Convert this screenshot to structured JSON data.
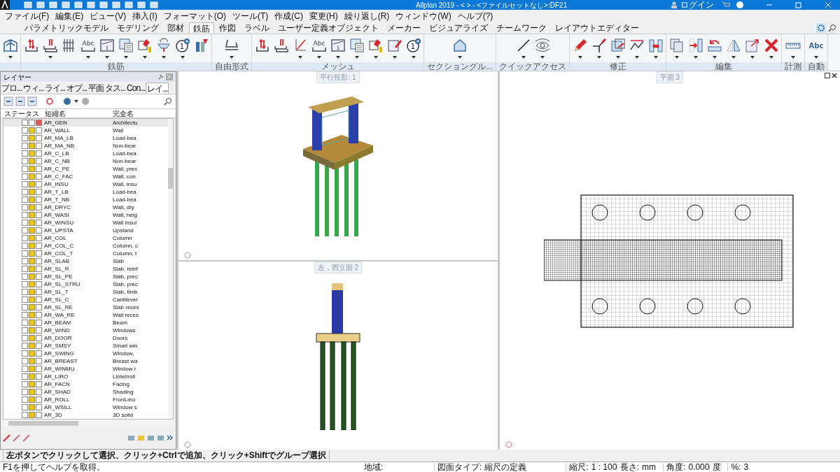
{
  "window": {
    "title": "Allplan 2019 - <        > - <ファイルセットなし>:DF21",
    "login": "ログイン"
  },
  "menu": [
    "ファイル(F)",
    "編集(E)",
    "ビュー(V)",
    "挿入(I)",
    "フォーマット(O)",
    "ツール(T)",
    "作成(C)",
    "変更(H)",
    "繰り返し(R)",
    "ウィンドウ(W)",
    "ヘルプ(?)"
  ],
  "ribbon_tabs": [
    {
      "label": "パラメトリックモデル",
      "selected": false
    },
    {
      "label": "モデリング",
      "selected": false
    },
    {
      "label": "部材",
      "selected": false
    },
    {
      "label": "鉄筋",
      "selected": true
    },
    {
      "label": "作図",
      "selected": false
    },
    {
      "label": "ラベル",
      "selected": false
    },
    {
      "label": "ユーザー定義オブジェクト",
      "selected": false
    },
    {
      "label": "メーカー",
      "selected": false
    },
    {
      "label": "ビジュアライズ",
      "selected": false
    },
    {
      "label": "チームワーク",
      "selected": false
    },
    {
      "label": "レイアウトエディター",
      "selected": false
    }
  ],
  "ribbon_groups": [
    {
      "buttons": [
        {
          "kind": "bridge",
          "dropdown": true
        }
      ]
    },
    {
      "label": "鉄筋",
      "buttons": [
        {
          "kind": "rebar",
          "dropdown": false
        },
        {
          "kind": "rebar-stack",
          "dropdown": true
        },
        {
          "kind": "bars",
          "dropdown": false
        },
        {
          "kind": "text",
          "text": "Abc",
          "dropdown": true
        },
        {
          "kind": "number-frame",
          "text": "1",
          "dropdown": true
        },
        {
          "kind": "sheet",
          "dropdown": true
        },
        {
          "kind": "paint",
          "dropdown": true
        },
        {
          "kind": "rotate-shape",
          "dropdown": true
        },
        {
          "kind": "number-circle",
          "text": "1",
          "dropdown": true
        },
        {
          "kind": "column-paint",
          "dropdown": false
        }
      ]
    },
    {
      "label": "自由形式",
      "buttons": [
        {
          "kind": "free-shape",
          "dropdown": true
        }
      ]
    },
    {
      "label": "メッシュ",
      "buttons": [
        {
          "kind": "rebar",
          "dropdown": false
        },
        {
          "kind": "rebar-stack",
          "dropdown": false
        },
        {
          "kind": "diagonal",
          "dropdown": true
        },
        {
          "kind": "text",
          "text": "Abc",
          "dropdown": true
        },
        {
          "kind": "number-frame",
          "text": "1",
          "dropdown": true
        },
        {
          "kind": "sheet",
          "dropdown": true
        },
        {
          "kind": "paint",
          "dropdown": true
        },
        {
          "kind": "pencil-frame",
          "dropdown": true
        },
        {
          "kind": "number-circle",
          "text": "1",
          "dropdown": true
        }
      ]
    },
    {
      "label": "セクショングル...",
      "buttons": [
        {
          "kind": "house",
          "dropdown": true
        }
      ]
    },
    {
      "label": "クイックアクセス",
      "buttons": [
        {
          "kind": "line",
          "dropdown": true
        },
        {
          "kind": "eye",
          "dropdown": true
        }
      ]
    },
    {
      "label": "修正",
      "buttons": [
        {
          "kind": "pencil",
          "dropdown": true
        },
        {
          "kind": "trim",
          "dropdown": true
        },
        {
          "kind": "copy-plane",
          "dropdown": true
        },
        {
          "kind": "zigzag",
          "dropdown": true
        },
        {
          "kind": "joint",
          "dropdown": true
        }
      ]
    },
    {
      "label": "編集",
      "buttons": [
        {
          "kind": "copy",
          "dropdown": true
        },
        {
          "kind": "move",
          "dropdown": true
        },
        {
          "kind": "rotate",
          "dropdown": true
        },
        {
          "kind": "mirror",
          "dropdown": true
        },
        {
          "kind": "scale",
          "dropdown": true
        },
        {
          "kind": "delete",
          "dropdown": true
        }
      ]
    },
    {
      "label": "計測",
      "buttons": [
        {
          "kind": "ruler",
          "dropdown": true
        }
      ]
    },
    {
      "label": "自動",
      "buttons": [
        {
          "kind": "plain-text",
          "text": "Abc",
          "dropdown": true
        }
      ]
    }
  ],
  "layer_panel": {
    "title": "レイヤー",
    "tabs": [
      {
        "label": "プロ...",
        "selected": false
      },
      {
        "label": "ウィ...",
        "selected": false
      },
      {
        "label": "ライ...",
        "selected": false
      },
      {
        "label": "オブ...",
        "selected": false
      },
      {
        "label": "平面",
        "selected": false
      },
      {
        "label": "タス...",
        "selected": false
      },
      {
        "label": "Con...",
        "selected": false
      },
      {
        "label": "レイ...",
        "selected": true
      }
    ],
    "columns": [
      "ステータス",
      "短縮名",
      "完全名"
    ],
    "rows": [
      {
        "short": "AR_GEN",
        "full": "Architectu",
        "current": true,
        "selected": true
      },
      {
        "short": "AR_WALL",
        "full": "Wall",
        "current": false,
        "selected": false
      },
      {
        "short": "AR_MA_LB",
        "full": "Load-bea",
        "current": false,
        "selected": false
      },
      {
        "short": "AR_MA_NB",
        "full": "Non-bear",
        "current": false,
        "selected": false
      },
      {
        "short": "AR_C_LB",
        "full": "Load-bea",
        "current": false,
        "selected": false
      },
      {
        "short": "AR_C_NB",
        "full": "Non-bear",
        "current": false,
        "selected": false
      },
      {
        "short": "AR_C_PE",
        "full": "Wall, prec",
        "current": false,
        "selected": false
      },
      {
        "short": "AR_C_FAC",
        "full": "Wall, con",
        "current": false,
        "selected": false
      },
      {
        "short": "AR_INSU",
        "full": "Wall, insu",
        "current": false,
        "selected": false
      },
      {
        "short": "AR_T_LB",
        "full": "Load-bea",
        "current": false,
        "selected": false
      },
      {
        "short": "AR_T_NB",
        "full": "Load-bea",
        "current": false,
        "selected": false
      },
      {
        "short": "AR_DRYC",
        "full": "Wall, dry",
        "current": false,
        "selected": false
      },
      {
        "short": "AR_WASI",
        "full": "Wall, heig",
        "current": false,
        "selected": false
      },
      {
        "short": "AR_WINSU",
        "full": "Wall insul",
        "current": false,
        "selected": false
      },
      {
        "short": "AR_UPSTA",
        "full": "Upstand",
        "current": false,
        "selected": false
      },
      {
        "short": "AR_COL",
        "full": "Column",
        "current": false,
        "selected": false
      },
      {
        "short": "AR_COL_C",
        "full": "Column, c",
        "current": false,
        "selected": false
      },
      {
        "short": "AR_COL_T",
        "full": "Column, t",
        "current": false,
        "selected": false
      },
      {
        "short": "AR_SLAB",
        "full": "Slab",
        "current": false,
        "selected": false
      },
      {
        "short": "AR_SL_R",
        "full": "Slab, reinf",
        "current": false,
        "selected": false
      },
      {
        "short": "AR_SL_PE",
        "full": "Slab, prec",
        "current": false,
        "selected": false
      },
      {
        "short": "AR_SL_STRU",
        "full": "Slab, prec",
        "current": false,
        "selected": false
      },
      {
        "short": "AR_SL_T",
        "full": "Slab, timb",
        "current": false,
        "selected": false
      },
      {
        "short": "AR_SL_C",
        "full": "Cantilever",
        "current": false,
        "selected": false
      },
      {
        "short": "AR_SL_RE",
        "full": "Slab reces",
        "current": false,
        "selected": false
      },
      {
        "short": "AR_WA_RE",
        "full": "Wall reces",
        "current": false,
        "selected": false
      },
      {
        "short": "AR_BEAM",
        "full": "Beam",
        "current": false,
        "selected": false
      },
      {
        "short": "AR_WIND",
        "full": "Windows",
        "current": false,
        "selected": false
      },
      {
        "short": "AR_DOOR",
        "full": "Doors",
        "current": false,
        "selected": false
      },
      {
        "short": "AR_SMSY",
        "full": "Smart win",
        "current": false,
        "selected": false
      },
      {
        "short": "AR_SWING",
        "full": "Window,",
        "current": false,
        "selected": false
      },
      {
        "short": "AR_BREAST",
        "full": "Breast wa",
        "current": false,
        "selected": false
      },
      {
        "short": "AR_WINMU",
        "full": "Window r",
        "current": false,
        "selected": false
      },
      {
        "short": "AR_LIRO",
        "full": "Lintel/roll",
        "current": false,
        "selected": false
      },
      {
        "short": "AR_FACN",
        "full": "Facing",
        "current": false,
        "selected": false
      },
      {
        "short": "AR_SHAD",
        "full": "Shading",
        "current": false,
        "selected": false
      },
      {
        "short": "AR_ROLL",
        "full": "Front-mo",
        "current": false,
        "selected": false
      },
      {
        "short": "AR_WSILL",
        "full": "Window s",
        "current": false,
        "selected": false
      },
      {
        "short": "AR_3D",
        "full": "3D solid",
        "current": false,
        "selected": false
      }
    ]
  },
  "viewports": [
    {
      "label": "平行投影: 1",
      "kind": "iso"
    },
    {
      "label": "左，西立面 2",
      "kind": "elevation"
    },
    {
      "label": "平面 3",
      "kind": "plan"
    }
  ],
  "prompt": "左ボタンでクリックして選択、クリック+Ctrlで追加、クリック+Shiftでグループ選択",
  "status_bar": {
    "help": "F1を押してヘルプを取得。",
    "region_label": "地域:",
    "drawing_type_label": "図面タイプ:",
    "drawing_type": "縮尺の定義",
    "scale_label": "縮尺:",
    "scale": "1 : 100",
    "length_label": "長さ:",
    "length_unit": "mm",
    "angle_label": "角度:",
    "angle": "0.000",
    "angle_unit": "度",
    "percent_label": "%:",
    "percent": "3"
  }
}
